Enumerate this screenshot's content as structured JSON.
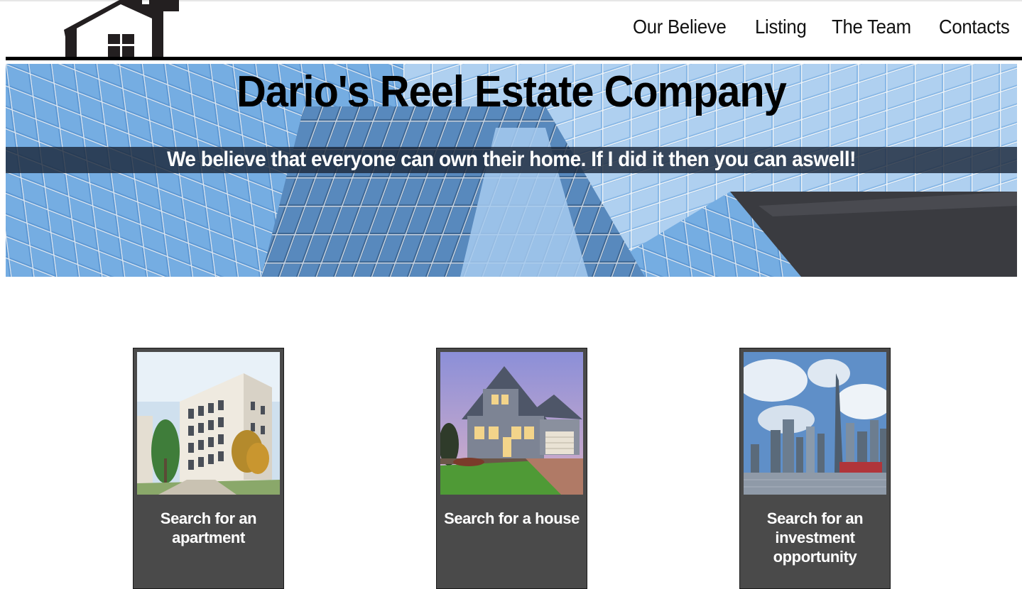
{
  "nav": {
    "items": [
      {
        "label": "Our Believe"
      },
      {
        "label": "Listing"
      },
      {
        "label": "The Team"
      },
      {
        "label": "Contacts"
      }
    ]
  },
  "hero": {
    "title": "Dario's Reel Estate Company",
    "subtitle": "We believe that everyone can own their home. If I did it then you can aswell!"
  },
  "cards": [
    {
      "label": "Search for an apartment"
    },
    {
      "label": "Search for a house"
    },
    {
      "label": "Search for an investment opportunity"
    }
  ]
}
